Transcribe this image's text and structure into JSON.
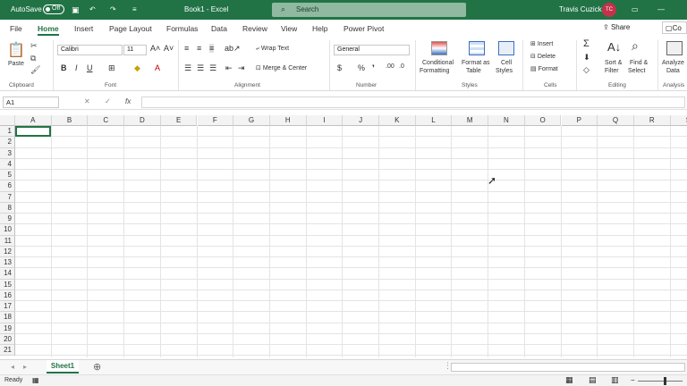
{
  "titlebar": {
    "autosave_label": "AutoSave",
    "autosave_state": "Off",
    "doc_title": "Book1 - Excel",
    "search_placeholder": "Search",
    "user_name": "Travis Cuzick",
    "user_initials": "TC"
  },
  "tabs": [
    "File",
    "Home",
    "Insert",
    "Page Layout",
    "Formulas",
    "Data",
    "Review",
    "View",
    "Help",
    "Power Pivot"
  ],
  "active_tab": "Home",
  "share_label": "Share",
  "comments_label": "Co",
  "ribbon": {
    "clipboard": {
      "name": "Clipboard",
      "paste": "Paste"
    },
    "font": {
      "name": "Font",
      "family": "Calibri",
      "size": "11"
    },
    "alignment": {
      "name": "Alignment",
      "wrap": "Wrap Text",
      "merge": "Merge & Center"
    },
    "number": {
      "name": "Number",
      "format": "General"
    },
    "styles": {
      "name": "Styles",
      "conditional_1": "Conditional",
      "conditional_2": "Formatting",
      "format_table_1": "Format as",
      "format_table_2": "Table",
      "cell_styles_1": "Cell",
      "cell_styles_2": "Styles"
    },
    "cells": {
      "name": "Cells",
      "insert": "Insert",
      "delete": "Delete",
      "format": "Format"
    },
    "editing": {
      "name": "Editing",
      "sort_1": "Sort &",
      "sort_2": "Filter",
      "find_1": "Find &",
      "find_2": "Select"
    },
    "analysis": {
      "name": "Analysis",
      "analyze_1": "Analyze",
      "analyze_2": "Data"
    }
  },
  "formula_bar": {
    "name_box": "A1",
    "fx": "fx"
  },
  "columns": [
    "A",
    "B",
    "C",
    "D",
    "E",
    "F",
    "G",
    "H",
    "I",
    "J",
    "K",
    "L",
    "M",
    "N",
    "O",
    "P",
    "Q",
    "R",
    "S"
  ],
  "rows": [
    "1",
    "2",
    "3",
    "4",
    "5",
    "6",
    "7",
    "8",
    "9",
    "10",
    "11",
    "12",
    "13",
    "14",
    "15",
    "16",
    "17",
    "18",
    "19",
    "20",
    "21"
  ],
  "sheets": [
    "Sheet1"
  ],
  "status": "Ready",
  "colors": {
    "accent": "#217346",
    "avatar": "#c4314b"
  }
}
